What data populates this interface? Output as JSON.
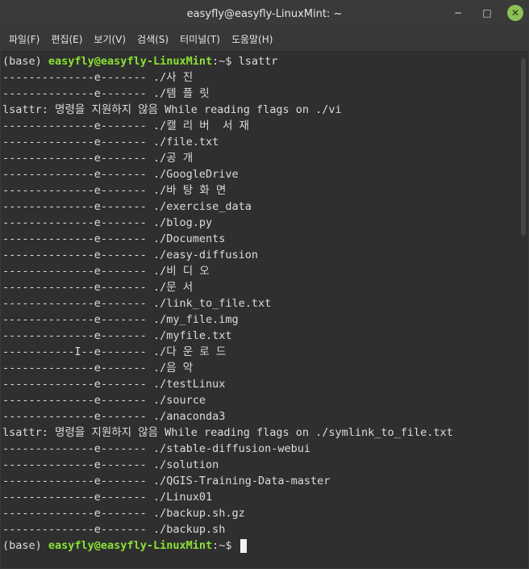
{
  "window": {
    "title": "easyfly@easyfly-LinuxMint: ~",
    "controls": {
      "minimize": "−",
      "maximize": "□",
      "close": "✕"
    }
  },
  "menu": [
    "파일(F)",
    "편집(E)",
    "보기(V)",
    "검색(S)",
    "터미널(T)",
    "도움말(H)"
  ],
  "terminal": {
    "prompt": {
      "env": "(base) ",
      "user_host": "easyfly@easyfly-LinuxMint",
      "path": ":~$ "
    },
    "command": "lsattr",
    "output_lines": [
      "--------------e------- ./사 진",
      "--------------e------- ./템 플 릿",
      "lsattr: 명령을 지원하지 않음 While reading flags on ./vi",
      "--------------e------- ./캘 리 버  서 재",
      "--------------e------- ./file.txt",
      "--------------e------- ./공 개",
      "--------------e------- ./GoogleDrive",
      "--------------e------- ./바 탕 화 면",
      "--------------e------- ./exercise_data",
      "--------------e------- ./blog.py",
      "--------------e------- ./Documents",
      "--------------e------- ./easy-diffusion",
      "--------------e------- ./비 디 오",
      "--------------e------- ./문 서",
      "--------------e------- ./link_to_file.txt",
      "--------------e------- ./my_file.img",
      "--------------e------- ./myfile.txt",
      "-----------I--e------- ./다 운 로 드",
      "--------------e------- ./음 악",
      "--------------e------- ./testLinux",
      "--------------e------- ./source",
      "--------------e------- ./anaconda3",
      "lsattr: 명령을 지원하지 않음 While reading flags on ./symlink_to_file.txt",
      "--------------e------- ./stable-diffusion-webui",
      "--------------e------- ./solution",
      "--------------e------- ./QGIS-Training-Data-master",
      "--------------e------- ./Linux01",
      "--------------e------- ./backup.sh.gz",
      "--------------e------- ./backup.sh"
    ]
  },
  "colors": {
    "background": "#2f2f2f",
    "text": "#dcdcdc",
    "prompt_user": "#8ae234",
    "close_button": "#8cc153"
  }
}
